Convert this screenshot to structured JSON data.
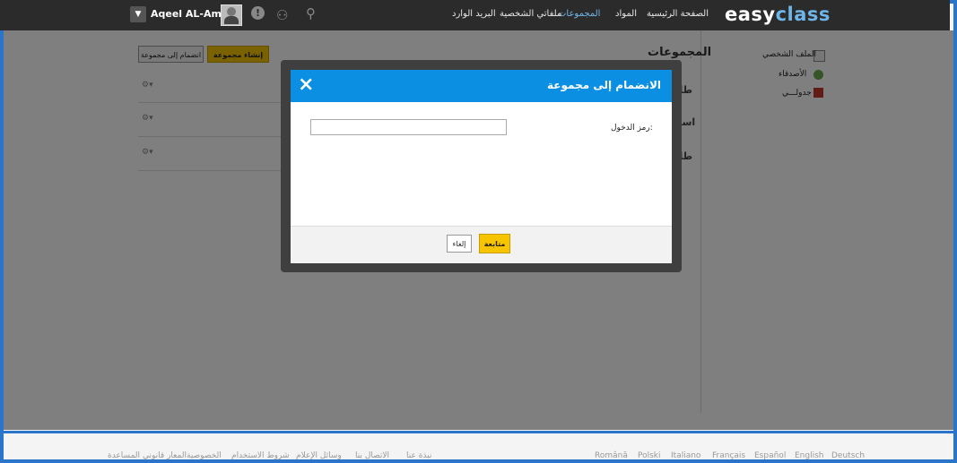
{
  "topbar": {
    "logo_part1": "easy",
    "logo_part2": "class",
    "nav": [
      "الصفحة الرئيسية",
      "المواد",
      "المجموعات",
      "ملفاتي الشخصية",
      "البريد الوارد"
    ],
    "active_nav": "المجموعات",
    "user_name": "Aqeel AL-Ameri",
    "icons": [
      "caret-down-icon",
      "avatar",
      "alert-icon",
      "people-icon",
      "search-icon"
    ]
  },
  "sidebar": {
    "items": [
      {
        "label": "الملف الشخصي",
        "icon": "profile-card-icon"
      },
      {
        "label": "الأصدقاء",
        "icon": "friends-icon"
      },
      {
        "label": "جدولـــي",
        "icon": "calendar-icon"
      }
    ]
  },
  "main": {
    "title": "المجموعات",
    "create_button": "إنشاء مجموعة",
    "join_button": "انضمام إلى مجموعة",
    "rows": [
      {
        "label": "طلبة"
      },
      {
        "label": "اساتذ"
      },
      {
        "label": "طلبة"
      }
    ]
  },
  "modal": {
    "title": "الانضمام إلى مجموعة",
    "close_icon": "×",
    "code_label": "رمز الدخول:",
    "code_value": "",
    "continue_button": "متابعة",
    "cancel_button": "إلغاء"
  },
  "footer": {
    "languages": [
      "Română",
      "Polski",
      "Italiano",
      "Français",
      "Español",
      "English",
      "Deutsch"
    ],
    "links": [
      "نبذة عنا",
      "الاتصال بنا",
      "وسائل الإعلام",
      "شروط الاستخدام",
      "الخصوصية",
      "المعار قانوني",
      "المساعدة"
    ]
  },
  "colors": {
    "accent": "#0b8fe3",
    "button_yellow": "#f6c400",
    "topbar": "#2b2b2b",
    "frame_border": "#2a74c9"
  }
}
